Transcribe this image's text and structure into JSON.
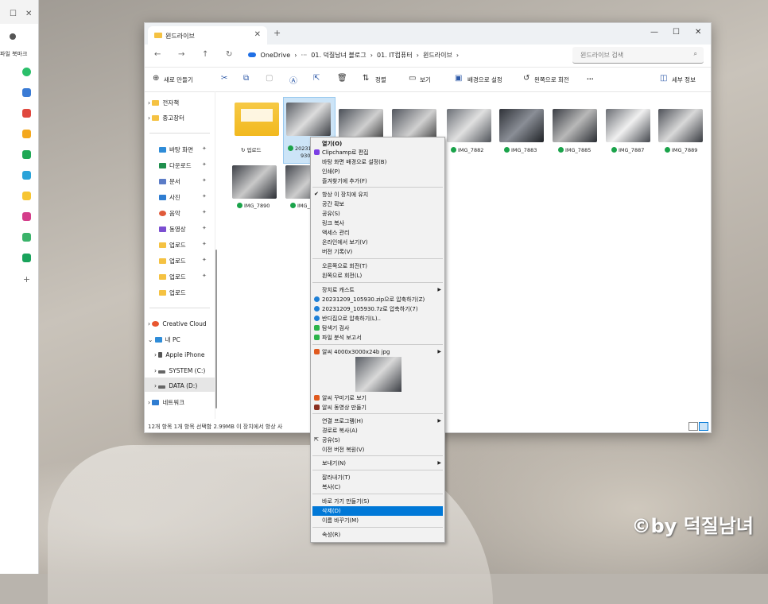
{
  "colors": {
    "accent": "#0078d7",
    "folder": "#f5c242",
    "check": "#1aa34a"
  },
  "bg_browser": {
    "bookmark_label": "파일 북마크"
  },
  "tab": {
    "title": "윈드라이브",
    "close": "✕",
    "new": "+"
  },
  "window": {
    "minimize": "—",
    "maximize": "☐",
    "close": "✕"
  },
  "nav": {
    "back": "←",
    "forward": "→",
    "up": "↑",
    "refresh": "↻"
  },
  "crumbs": [
    "OneDrive",
    "›",
    "···",
    "01. 덕질남녀 블로그",
    "›",
    "01. IT컴퓨터",
    "›",
    "윈드라이브",
    "›"
  ],
  "search": {
    "placeholder": "윈드라이브 검색",
    "icon": "search-icon"
  },
  "toolbar": {
    "new": "새로 만들기",
    "sort": "정렬",
    "view": "보기",
    "set_bg": "배경으로 설정",
    "rotate_left": "왼쪽으로 회전",
    "more": "···",
    "details": "세부 정보"
  },
  "sidebar": {
    "top": [
      "전자책",
      "중고장터"
    ],
    "quick": [
      {
        "label": "바탕 화면",
        "color": "#2f8cd8"
      },
      {
        "label": "다운로드",
        "color": "#1f8f4d"
      },
      {
        "label": "문서",
        "color": "#5b7cc7"
      },
      {
        "label": "사진",
        "color": "#2f7dd1"
      },
      {
        "label": "음악",
        "color": "#e05a3a"
      },
      {
        "label": "동영상",
        "color": "#7b4fd1"
      },
      {
        "label": "업로드",
        "color": "#f5c242"
      },
      {
        "label": "업로드",
        "color": "#f5c242"
      },
      {
        "label": "업로드",
        "color": "#f5c242"
      },
      {
        "label": "업로드",
        "color": "#f5c242"
      }
    ],
    "tree": [
      "Creative Cloud",
      "내 PC",
      "Apple iPhone",
      "SYSTEM (C:)",
      "DATA (D:)",
      "네트워크"
    ]
  },
  "files": [
    {
      "name": "업로드",
      "kind": "folder"
    },
    {
      "name": "20231209_105930",
      "kind": "selected"
    },
    {
      "name": "IMG_7882",
      "kind": "photo"
    },
    {
      "name": "IMG_7883",
      "kind": "photo"
    },
    {
      "name": "IMG_7885",
      "kind": "photo"
    },
    {
      "name": "IMG_7887",
      "kind": "photo"
    },
    {
      "name": "IMG_7889",
      "kind": "photo"
    },
    {
      "name": "IMG_7890",
      "kind": "photo"
    },
    {
      "name": "IMG_",
      "kind": "photo"
    }
  ],
  "file_label_selected": {
    "line1": "202312",
    "line2": "930"
  },
  "status": {
    "text": "12개 항목   1개 항목 선택함 2.99MB   이 장치에서 항상 사"
  },
  "menu": {
    "open": "열기(O)",
    "clipchamp": "Clipchamp로 편집",
    "set_bg": "바탕 화면 배경으로 설정(B)",
    "print": "인쇄(P)",
    "favorite": "즐겨찾기에 추가(F)",
    "keep": "항상 이 장치에 유지",
    "free": "공간 확보",
    "share": "공유(S)",
    "copy_link": "링크 복사",
    "manage_access": "액세스 관리",
    "view_online": "온라인에서 보기(V)",
    "history": "버전 기록(V)",
    "rotate_right": "오른쪽으로 회전(T)",
    "rotate_left": "왼쪽으로 회전(L)",
    "cast": "장치로 캐스트",
    "zip": "20231209_105930.zip으로 압축하기(Z)",
    "7z": "20231209_105930.7z로 압축하기(7)",
    "bandizip": "반디집으로 압축하기(L)..",
    "scan": "탐색기 검사",
    "report": "파일 분석 보고서",
    "alsee": "알씨 4000x3000x24b jpg",
    "alsee_decorate": "알씨 꾸미기로 보기",
    "alsee_video": "알씨 동영상 만들기",
    "open_with": "연결 프로그램(H)",
    "copy_path": "경로로 복사(A)",
    "share2": "공유(S)",
    "restore": "이전 버전 복원(V)",
    "send_to": "보내기(N)",
    "cut": "잘라내기(T)",
    "copy": "복사(C)",
    "shortcut": "바로 가기 만들기(S)",
    "delete": "삭제(D)",
    "rename": "이름 바꾸기(M)",
    "properties": "속성(R)"
  },
  "watermark": "©by 덕질남녀"
}
